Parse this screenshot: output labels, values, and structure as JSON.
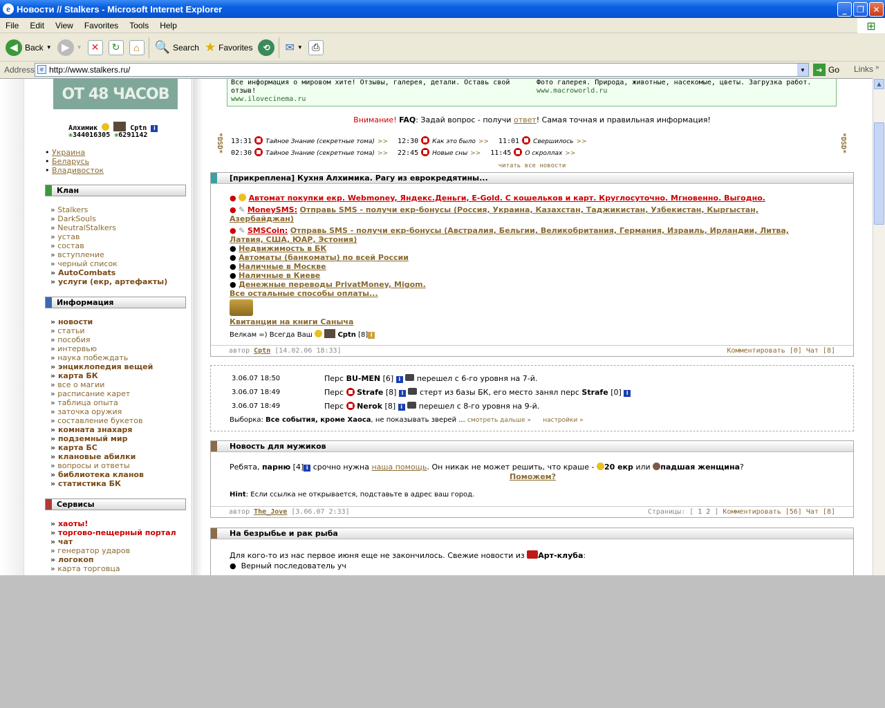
{
  "window": {
    "title": "Новости // Stalkers - Microsoft Internet Explorer"
  },
  "menu": [
    "File",
    "Edit",
    "View",
    "Favorites",
    "Tools",
    "Help"
  ],
  "toolbar": {
    "back": "Back",
    "search": "Search",
    "favorites": "Favorites"
  },
  "address": {
    "label": "Address",
    "url": "http://www.stalkers.ru/",
    "go": "Go",
    "links": "Links"
  },
  "left": {
    "banner": "ОТ 48 ЧАСОВ",
    "user1": "Алхимик",
    "user2": "Cptn",
    "num1": "344016305",
    "num2": "6291142",
    "regions": [
      "Украина",
      "Беларусь",
      "Владивосток"
    ],
    "sections": {
      "clan": {
        "title": "Клан",
        "items": [
          {
            "t": "Stalkers",
            "s": ""
          },
          {
            "t": "DarkSouls",
            "s": ""
          },
          {
            "t": "NeutralStalkers",
            "s": ""
          },
          {
            "t": "устав",
            "s": ""
          },
          {
            "t": "состав",
            "s": ""
          },
          {
            "t": "вступление",
            "s": ""
          },
          {
            "t": "черный список",
            "s": ""
          },
          {
            "t": "AutoCombats",
            "s": "b"
          },
          {
            "t": "услуги (екр, артефакты)",
            "s": "b"
          }
        ]
      },
      "info": {
        "title": "Информация",
        "items": [
          {
            "t": "новости",
            "s": "b"
          },
          {
            "t": "статьи",
            "s": ""
          },
          {
            "t": "пособия",
            "s": ""
          },
          {
            "t": "интервью",
            "s": ""
          },
          {
            "t": "наука побеждать",
            "s": ""
          },
          {
            "t": "энциклопедия вещей",
            "s": "b"
          },
          {
            "t": "карта БК",
            "s": "b"
          },
          {
            "t": "все о магии",
            "s": ""
          },
          {
            "t": "расписание карет",
            "s": ""
          },
          {
            "t": "таблица опыта",
            "s": ""
          },
          {
            "t": "заточка оружия",
            "s": ""
          },
          {
            "t": "составление букетов",
            "s": ""
          },
          {
            "t": "комната знахаря",
            "s": "b"
          },
          {
            "t": "подземный мир",
            "s": "b"
          },
          {
            "t": "карта БС",
            "s": "b"
          },
          {
            "t": "клановые абилки",
            "s": "b"
          },
          {
            "t": "вопросы и ответы",
            "s": ""
          },
          {
            "t": "библиотека кланов",
            "s": "b"
          },
          {
            "t": "статистика БК",
            "s": "b"
          }
        ]
      },
      "services": {
        "title": "Сервисы",
        "items": [
          {
            "t": "хаоты!",
            "s": "r"
          },
          {
            "t": "торгово-пещерный портал",
            "s": "r"
          },
          {
            "t": "чат",
            "s": "b"
          },
          {
            "t": "генератор ударов",
            "s": ""
          },
          {
            "t": "логокоп",
            "s": "b"
          },
          {
            "t": "карта торговца",
            "s": ""
          }
        ]
      }
    }
  },
  "ads": {
    "left": "Все информация о мировом хите! Отзывы, галерея, детали. Оставь свой отзыв!",
    "left_url": "www.ilovecinema.ru",
    "right": "Фото галерея. Природа, животные, насекомые, цветы. Загрузка работ.",
    "right_url": "www.macroworld.ru"
  },
  "faq": {
    "attention": "Внимание!",
    "faq": "FAQ",
    "text1": ": Задай вопрос - получи ",
    "answer": "ответ",
    "text2": "! Самая точная и правильная информация!"
  },
  "ticker": {
    "dsd": "*DSD*",
    "row1": [
      {
        "time": "13:31",
        "text": "Тайное Знание (секретные тома)"
      },
      {
        "time": "12:30",
        "text": "Как это было"
      },
      {
        "time": "11:01",
        "text": "Свершилось"
      }
    ],
    "row2": [
      {
        "time": "02:30",
        "text": "Тайное Знание (секретные тома)"
      },
      {
        "time": "22:45",
        "text": "Новые сны"
      },
      {
        "time": "11:45",
        "text": "О скроллах"
      }
    ],
    "arrows": ">>",
    "all": "читать все новости"
  },
  "pinned": {
    "title": "[прикреплена] Кухня Алхимика. Рагу из еврокредятины...",
    "l1": "Автомат покупки екр. Webmoney, Яндекс.Деньги, E-Gold. С кошельков и карт. Круглосуточно. Мгновенно. Выгодно.",
    "l2a": "MoneySMS:",
    "l2b": "Отправь SMS - получи екр-бонусы (Россия, Украина, Казахстан, Таджикистан, Узбекистан, Кыргыстан,",
    "l2c": "Азербайджан)",
    "l3a": "SMSCoin:",
    "l3b": "Отправь SMS - получи екр-бонусы (Австралия, Бельгии, Великобритания, Германия, Израиль, Ирландии, Литва,",
    "l3c": "Латвия, США, ЮАР, Эстония)",
    "items": [
      "Недвижимость в БК",
      "Автоматы (банкоматы) по всей России",
      "Наличные в Москве",
      "Наличные в Киеве",
      "Денежные переводы PrivatMoney, Migom."
    ],
    "all": "Все остальные способы оплаты...",
    "kv": "Квитанции на книги Саныча",
    "welcome": "Велкам =) Всегда Ваш",
    "cptn": "Cptn",
    "lvl": "[8]",
    "author_label": "автор",
    "author": "Cptn",
    "date": "[14.02.06 18:33]",
    "comment": "Комментировать [0]",
    "chat": "Чат [8]"
  },
  "events": {
    "rows": [
      {
        "date": "3.06.07 18:50",
        "pre": "Перс",
        "name": "BU-MEN",
        "lvl": "[6]",
        "text": "перешел с 6-го уровня на 7-й."
      },
      {
        "date": "3.06.07 18:49",
        "pre": "Перс",
        "name": "Strafe",
        "lvl": "[8]",
        "text": "стерт из базы БК, его место занял перс",
        "name2": "Strafe",
        "lvl2": "[0]"
      },
      {
        "date": "3.06.07 18:49",
        "pre": "Перс",
        "name": "Nerok",
        "lvl": "[8]",
        "text": "перешел с 8-го уровня на 9-й."
      }
    ],
    "sel_label": "Выборка:",
    "sel": "Все события, кроме Хаоса",
    "sel_tail": ", не показывать зверей ...",
    "more": "смотреть дальше »",
    "settings": "настройки »"
  },
  "news1": {
    "title": "Новость для мужиков",
    "t1": "Ребята,",
    "name": "парню",
    "lvl": "[4]",
    "t2": "срочно нужна",
    "help": "наша помощь",
    "t3": ". Он никак не может решить, что краше -",
    "ekr": "20 екр",
    "or": "или",
    "woman": "падшая женщина",
    "q": "?",
    "help2": "Поможем?",
    "hint_label": "Hint",
    "hint": ": Если ссылка не открывается, подставьте в адрес ваш город.",
    "author_label": "автор",
    "author": "The_Jove",
    "date": "[3.06.07 2:33]",
    "pages": "Страницы: [",
    "p1": "1",
    "p2": "2",
    "pages_end": "]",
    "comment": "Комментировать [56]",
    "chat": "Чат [8]"
  },
  "news2": {
    "title": "На безрыбье и рак рыба",
    "t1": "Для кого-то из нас первое июня еще не закончилось. Свежие новости из",
    "club": "Арт-клуба",
    "t2": "Верный последователь уч"
  }
}
